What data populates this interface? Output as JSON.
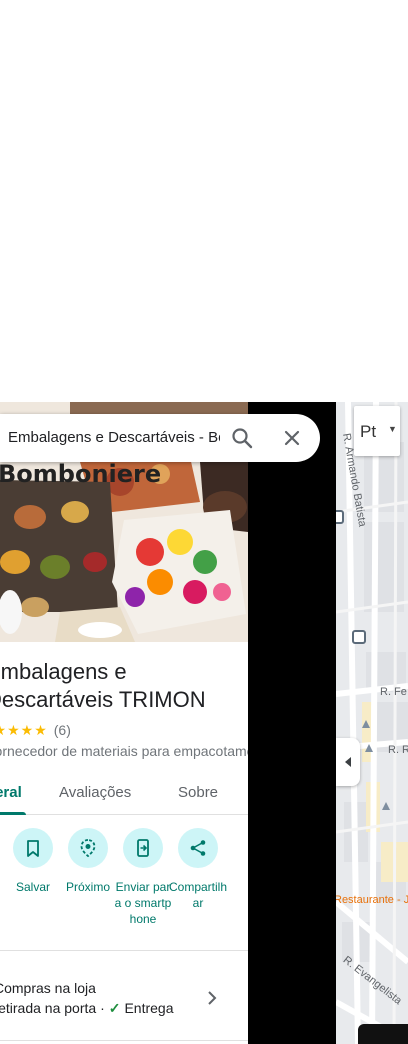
{
  "search": {
    "query": "Embalagens e Descartáveis - Bom"
  },
  "hero": {
    "brand_text": "Bomboniere"
  },
  "place": {
    "title": "Embalagens e Descartáveis TRIMON",
    "rating_stars": "★★★★★",
    "review_count": "(6)",
    "category": "Fornecedor de materiais para empacotamento"
  },
  "tabs": [
    {
      "label": "Visão geral"
    },
    {
      "label": "Avaliações"
    },
    {
      "label": "Sobre"
    }
  ],
  "actions": [
    {
      "label": "Salvar",
      "icon": "bookmark-icon"
    },
    {
      "label": "Próximo",
      "icon": "nearby-icon"
    },
    {
      "label": "Enviar para o smartphone",
      "icon": "send-to-phone-icon"
    },
    {
      "label": "Compartilhar",
      "icon": "share-icon"
    }
  ],
  "service": {
    "line1": "Compras na loja",
    "line2_prefix": "Retirada na porta ·",
    "line2_suffix": "Entrega"
  },
  "map": {
    "language_button": "Pt",
    "streets": [
      "R. Armando Batista",
      "R. Fe",
      "R. R",
      "R. Evangelista"
    ],
    "poi": "Restaurante - João Mo"
  },
  "colors": {
    "accent": "#00796b",
    "star": "#fbbc04",
    "action_bg": "#cdf5f7"
  }
}
